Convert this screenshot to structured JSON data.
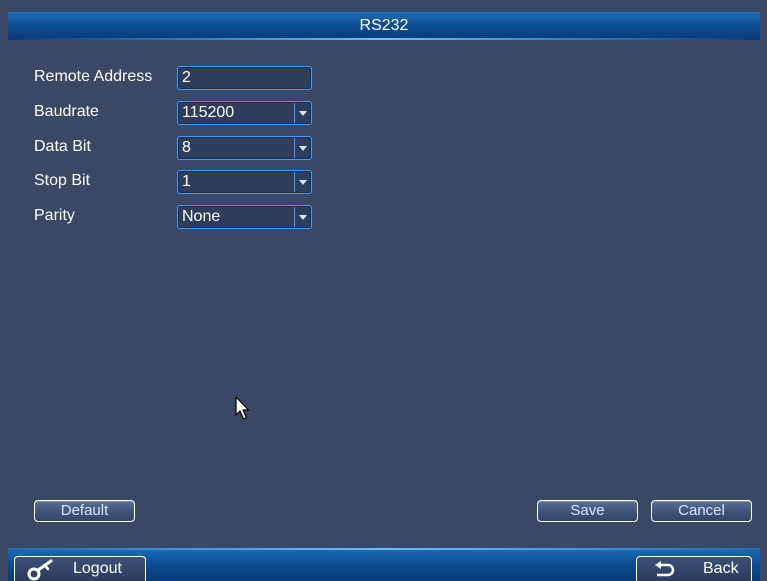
{
  "window": {
    "title": "RS232"
  },
  "form": {
    "remote_address": {
      "label": "Remote Address",
      "value": "2"
    },
    "baudrate": {
      "label": "Baudrate",
      "value": "115200"
    },
    "data_bit": {
      "label": "Data Bit",
      "value": "8"
    },
    "stop_bit": {
      "label": "Stop Bit",
      "value": "1"
    },
    "parity": {
      "label": "Parity",
      "value": "None"
    }
  },
  "buttons": {
    "default_label": "Default",
    "save_label": "Save",
    "cancel_label": "Cancel"
  },
  "nav": {
    "logout_label": "Logout",
    "back_label": "Back"
  },
  "icons": {
    "logout": "key-icon",
    "back": "return-arrow-icon",
    "dropdown": "chevron-down-icon",
    "cursor": "mouse-pointer-icon"
  },
  "colors": {
    "background": "#3a4865",
    "titlebar": "#0d4f95",
    "field_border": "#3aa0ff"
  }
}
